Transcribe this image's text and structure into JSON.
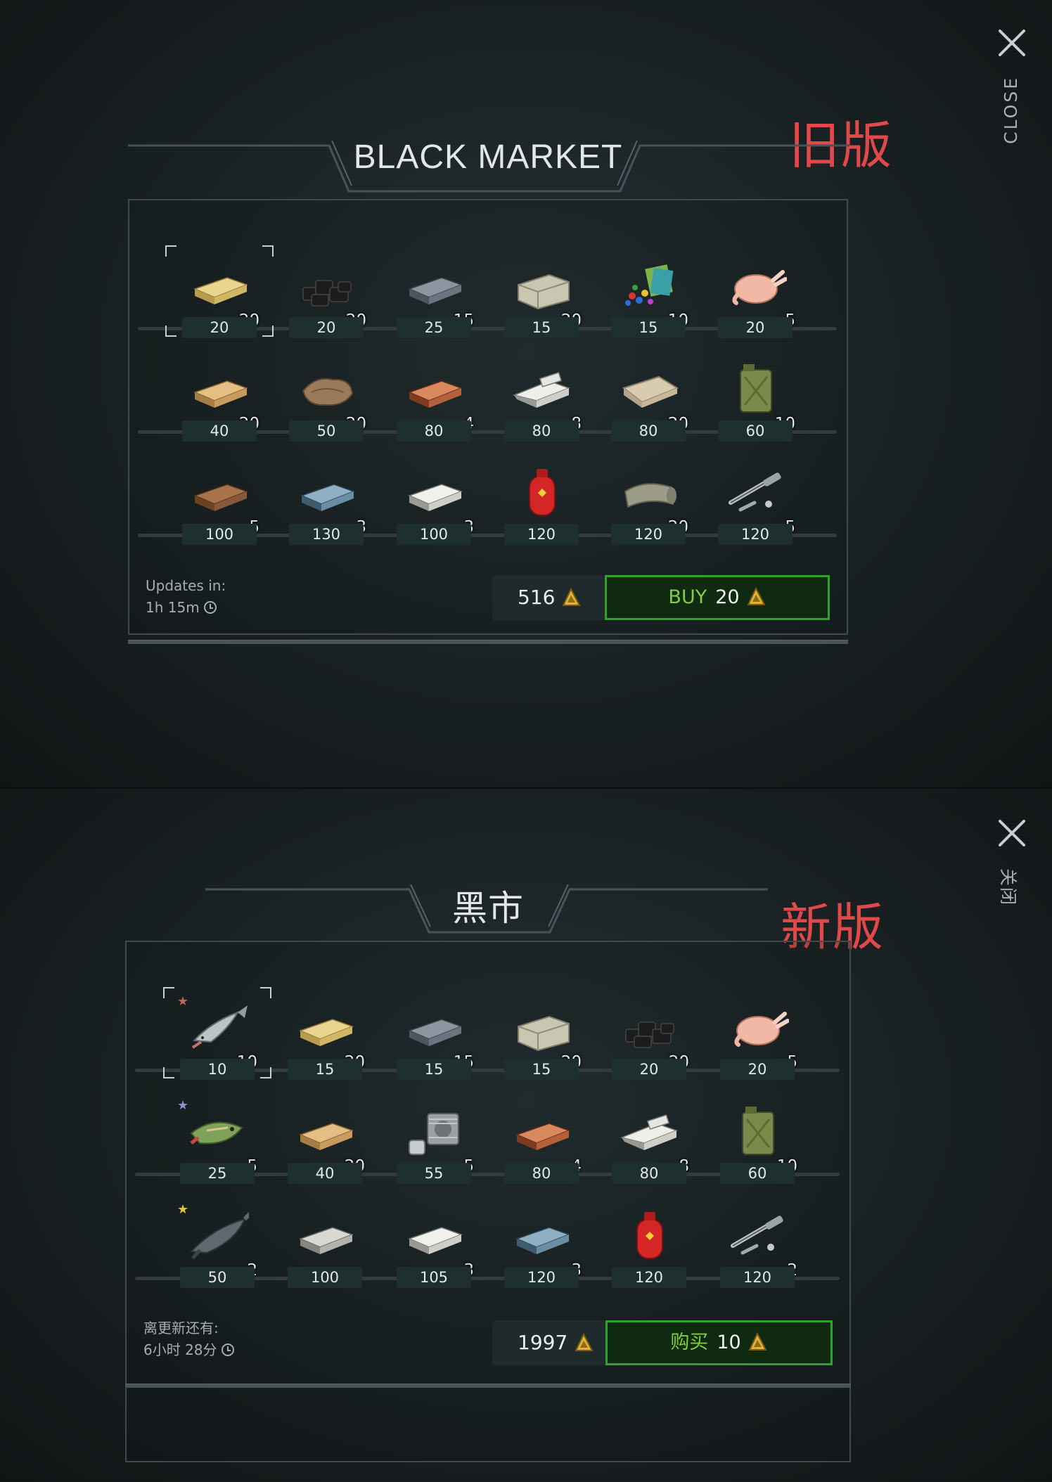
{
  "old_panel": {
    "version_tag": "旧版",
    "close_label": "CLOSE",
    "title": "BLACK MARKET",
    "rows": [
      [
        {
          "icon": "wood-plank-icon",
          "qty": "20",
          "price": "20",
          "selected": true
        },
        {
          "icon": "coal-icon",
          "qty": "20",
          "price": "20"
        },
        {
          "icon": "iron-bar-icon",
          "qty": "15",
          "price": "25"
        },
        {
          "icon": "stone-block-icon",
          "qty": "20",
          "price": "15"
        },
        {
          "icon": "chemicals-icon",
          "qty": "10",
          "price": "15"
        },
        {
          "icon": "raw-chicken-icon",
          "qty": "5",
          "price": "20"
        }
      ],
      [
        {
          "icon": "board-icon",
          "qty": "20",
          "price": "40"
        },
        {
          "icon": "leather-icon",
          "qty": "20",
          "price": "50"
        },
        {
          "icon": "copper-bar-icon",
          "qty": "4",
          "price": "80"
        },
        {
          "icon": "aluminum-bars-icon",
          "qty": "8",
          "price": "80"
        },
        {
          "icon": "cloth-icon",
          "qty": "20",
          "price": "80"
        },
        {
          "icon": "jerrycan-icon",
          "qty": "10",
          "price": "60"
        }
      ],
      [
        {
          "icon": "oak-plank-icon",
          "qty": "5",
          "price": "100"
        },
        {
          "icon": "steel-bar-icon",
          "qty": "3",
          "price": "130"
        },
        {
          "icon": "silver-bar-icon",
          "qty": "3",
          "price": "100"
        },
        {
          "icon": "gas-cylinder-icon",
          "qty": "",
          "price": "120"
        },
        {
          "icon": "wool-roll-icon",
          "qty": "20",
          "price": "120"
        },
        {
          "icon": "rifle-parts-icon",
          "qty": "5",
          "price": "120"
        }
      ]
    ],
    "updates_label": "Updates in:",
    "updates_time": "1h 15m",
    "balance": "516",
    "buy_label": "BUY",
    "buy_cost": "20"
  },
  "new_panel": {
    "version_tag": "新版",
    "close_label": "关闭",
    "title": "黑市",
    "rows": [
      [
        {
          "icon": "salmon-icon",
          "qty": "10",
          "price": "10",
          "selected": true,
          "star": "#c0665a"
        },
        {
          "icon": "wood-plank-icon",
          "qty": "20",
          "price": "15"
        },
        {
          "icon": "iron-bar-icon",
          "qty": "15",
          "price": "15"
        },
        {
          "icon": "stone-block-icon",
          "qty": "20",
          "price": "15"
        },
        {
          "icon": "coal-icon",
          "qty": "20",
          "price": "20"
        },
        {
          "icon": "raw-chicken-icon",
          "qty": "5",
          "price": "20"
        }
      ],
      [
        {
          "icon": "pike-icon",
          "qty": "5",
          "price": "25",
          "star": "#8a8fd6"
        },
        {
          "icon": "board-icon",
          "qty": "20",
          "price": "40"
        },
        {
          "icon": "engine-cylinder-icon",
          "qty": "5",
          "price": "55"
        },
        {
          "icon": "copper-bar-icon",
          "qty": "4",
          "price": "80"
        },
        {
          "icon": "aluminum-bars-icon",
          "qty": "8",
          "price": "80"
        },
        {
          "icon": "jerrycan-icon",
          "qty": "10",
          "price": "60"
        }
      ],
      [
        {
          "icon": "sturgeon-icon",
          "qty": "2",
          "price": "50",
          "star": "#e8c53a"
        },
        {
          "icon": "titanium-bar-icon",
          "qty": "",
          "price": "100"
        },
        {
          "icon": "silver-bar-icon",
          "qty": "3",
          "price": "105"
        },
        {
          "icon": "steel-bar-icon",
          "qty": "3",
          "price": "120"
        },
        {
          "icon": "gas-cylinder-icon",
          "qty": "",
          "price": "120"
        },
        {
          "icon": "rifle-parts-icon",
          "qty": "2",
          "price": "120"
        }
      ]
    ],
    "updates_label": "离更新还有:",
    "updates_time": "6小时 28分",
    "balance": "1997",
    "buy_label": "购买",
    "buy_cost": "10"
  },
  "colors": {
    "accent_green": "#2fa12d",
    "buy_text_green": "#7fcf3f",
    "version_tag_red": "#e0484a",
    "coin_gold": "#e2b13a"
  }
}
